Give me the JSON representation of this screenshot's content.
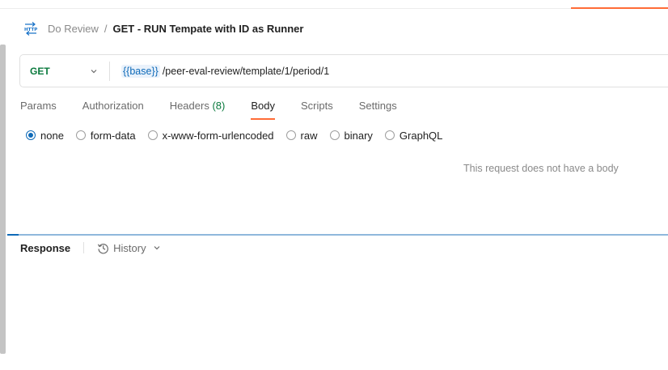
{
  "breadcrumb": {
    "parent": "Do Review",
    "separator": "/",
    "current": "GET - RUN Tempate with ID as Runner"
  },
  "request": {
    "method": "GET",
    "url_variable": "{{base}}",
    "url_path": "/peer-eval-review/template/1/period/1"
  },
  "tabs": [
    {
      "label": "Params"
    },
    {
      "label": "Authorization"
    },
    {
      "label": "Headers",
      "count": "(8)"
    },
    {
      "label": "Body",
      "active": true
    },
    {
      "label": "Scripts"
    },
    {
      "label": "Settings"
    }
  ],
  "body_types": [
    {
      "label": "none",
      "selected": true
    },
    {
      "label": "form-data"
    },
    {
      "label": "x-www-form-urlencoded"
    },
    {
      "label": "raw"
    },
    {
      "label": "binary"
    },
    {
      "label": "GraphQL"
    }
  ],
  "body_empty_message": "This request does not have a body",
  "response": {
    "label": "Response",
    "history_label": "History"
  },
  "colors": {
    "accent": "#ff6c37",
    "method_get": "#0b7a3e",
    "link_blue": "#0e6ab8"
  },
  "icons": {
    "request_type": "http-icon",
    "history": "history-icon",
    "dropdown": "chevron-down-icon"
  }
}
